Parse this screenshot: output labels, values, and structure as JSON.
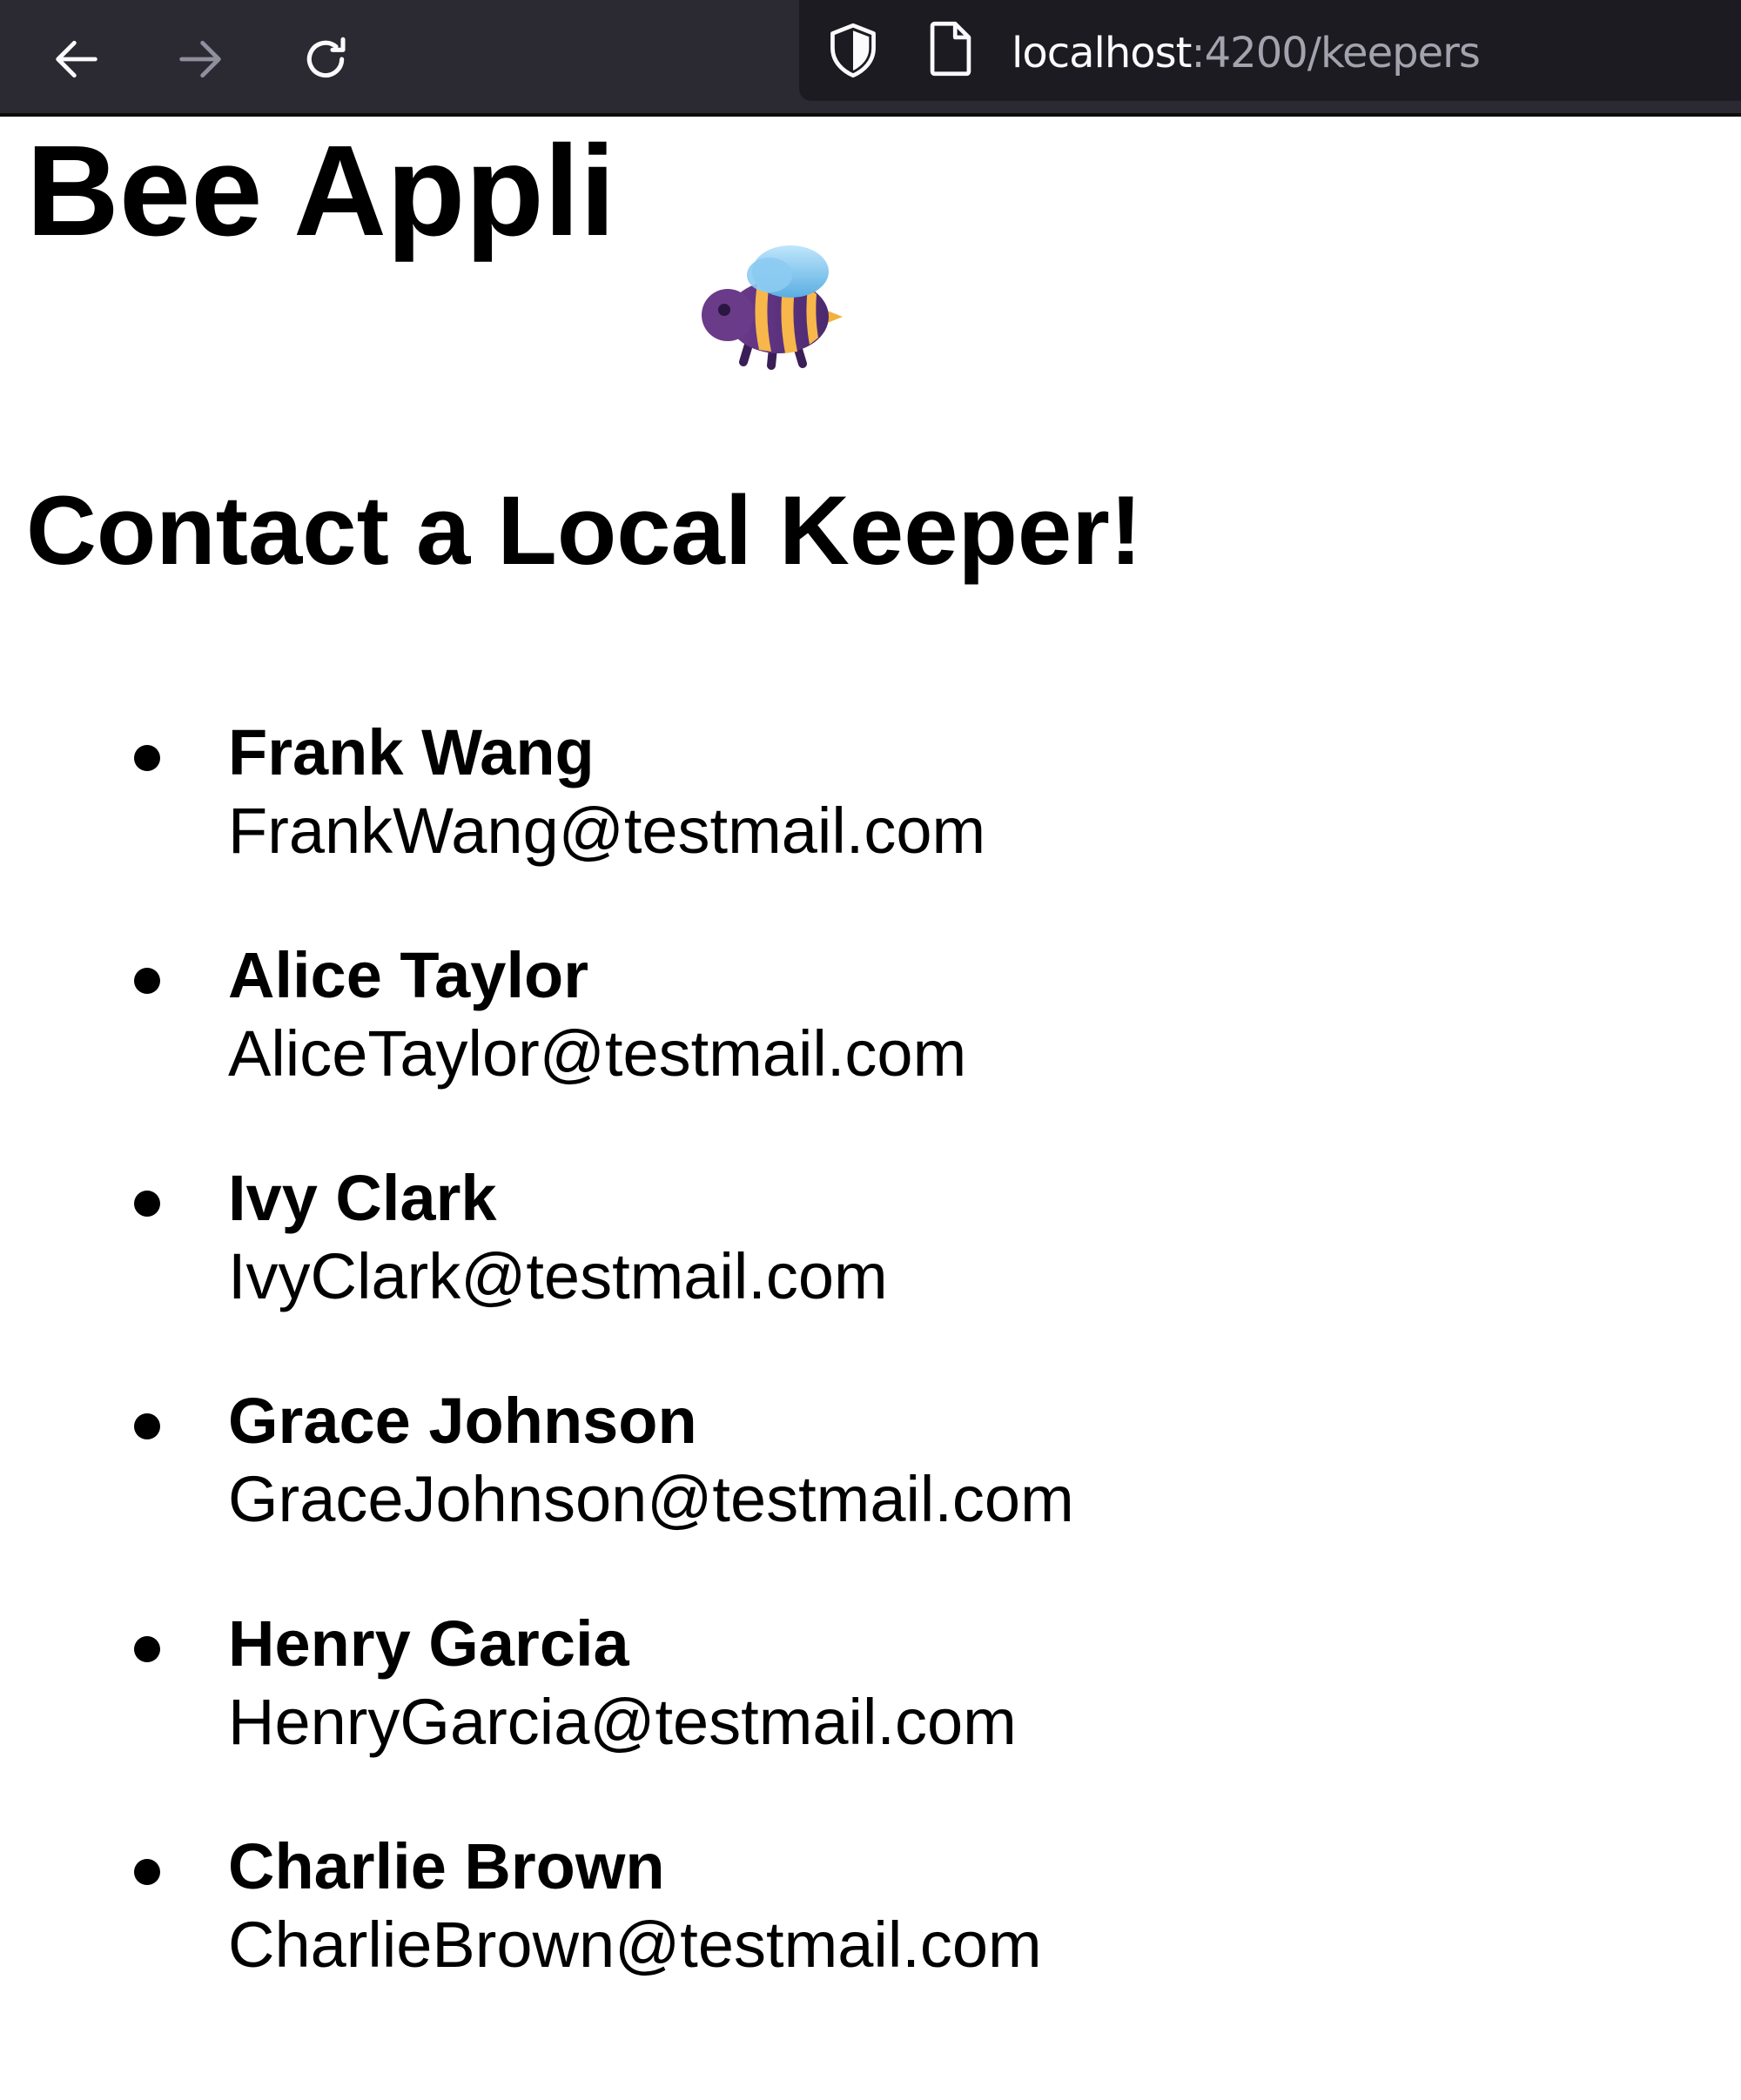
{
  "browser": {
    "url_host": "localhost",
    "url_path": ":4200/keepers",
    "icons": {
      "back": "arrow-left-icon",
      "forward": "arrow-right-icon",
      "reload": "reload-icon",
      "tracking": "shield-icon",
      "page": "page-icon"
    },
    "colors": {
      "toolbar": "#2b2a33",
      "urlbar": "#1c1b22",
      "url_host": "#fbfbfe",
      "url_path": "#a3a3ad"
    }
  },
  "page": {
    "title": "Bee Appli",
    "title_icon": "bee-emoji-icon",
    "heading": "Contact a Local Keeper!"
  },
  "keepers": [
    {
      "name": "Frank Wang",
      "email": "FrankWang@testmail.com"
    },
    {
      "name": "Alice Taylor",
      "email": "AliceTaylor@testmail.com"
    },
    {
      "name": "Ivy Clark",
      "email": "IvyClark@testmail.com"
    },
    {
      "name": "Grace Johnson",
      "email": "GraceJohnson@testmail.com"
    },
    {
      "name": "Henry Garcia",
      "email": "HenryGarcia@testmail.com"
    },
    {
      "name": "Charlie Brown",
      "email": "CharlieBrown@testmail.com"
    }
  ]
}
